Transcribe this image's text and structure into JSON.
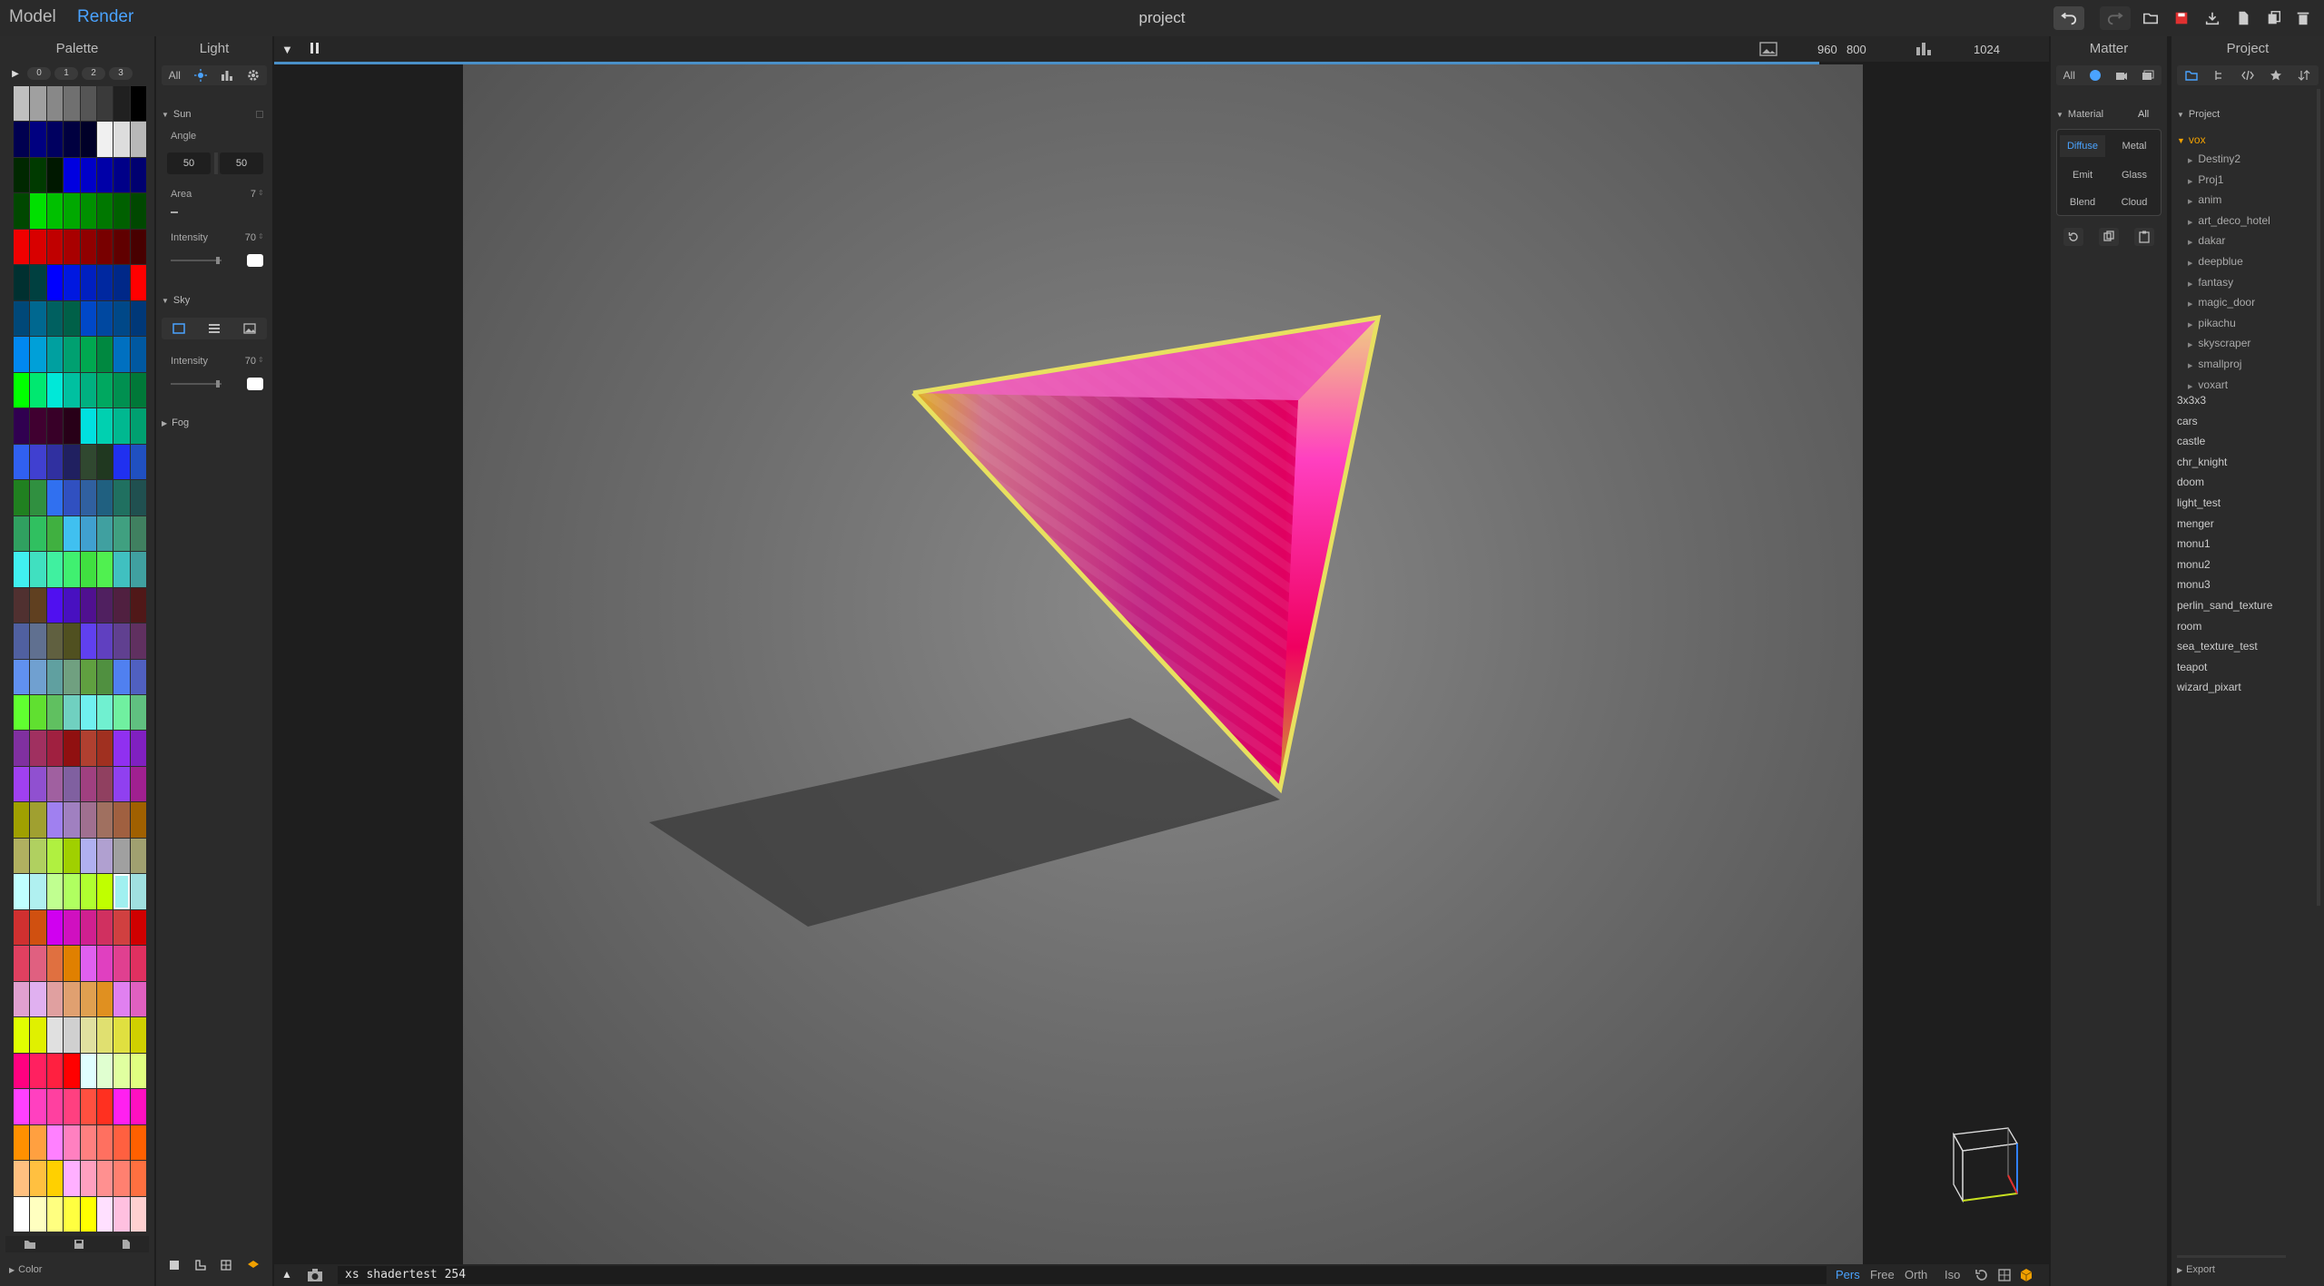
{
  "topbar": {
    "modes": [
      "Model",
      "Render"
    ],
    "active_mode": "Render",
    "title": "project",
    "icons": [
      "undo-icon",
      "redo-icon",
      "open-folder-icon",
      "save-icon",
      "download-icon",
      "new-file-icon",
      "duplicate-icon",
      "trash-icon"
    ]
  },
  "palette": {
    "title": "Palette",
    "play_label": "▶",
    "tabs": [
      "0",
      "1",
      "2",
      "3"
    ],
    "colors": [
      "#c0c0c0",
      "#a0a0a0",
      "#888888",
      "#707070",
      "#555555",
      "#3a3a3a",
      "#202020",
      "#000000",
      "#000050",
      "#000080",
      "#000060",
      "#000040",
      "#000028",
      "#f0f0f0",
      "#dddddd",
      "#b8b8b8",
      "#002800",
      "#003a00",
      "#001800",
      "#0000e0",
      "#0000c8",
      "#0000a8",
      "#000088",
      "#000070",
      "#004800",
      "#00e000",
      "#00c000",
      "#00a800",
      "#009000",
      "#007800",
      "#006000",
      "#004800",
      "#f00000",
      "#d80000",
      "#c00000",
      "#a80000",
      "#900000",
      "#780000",
      "#600000",
      "#480000",
      "#003030",
      "#004040",
      "#0000ff",
      "#0018e0",
      "#0020c0",
      "#0028a0",
      "#002888",
      "#ff0000",
      "#004878",
      "#006890",
      "#006060",
      "#006048",
      "#0048c8",
      "#0048a0",
      "#004888",
      "#003878",
      "#0088f0",
      "#00a0d8",
      "#00a0a0",
      "#00a070",
      "#00a850",
      "#008840",
      "#0070c0",
      "#0058a0",
      "#00ff00",
      "#00e870",
      "#00e8d8",
      "#00c0a0",
      "#00b080",
      "#00a860",
      "#009050",
      "#007838",
      "#300050",
      "#400030",
      "#380028",
      "#280018",
      "#00e0e0",
      "#00d0b0",
      "#00b890",
      "#00a070",
      "#3060f0",
      "#4040d0",
      "#3030a0",
      "#202060",
      "#304830",
      "#203820",
      "#2030f0",
      "#2050c0",
      "#208020",
      "#309040",
      "#3070f0",
      "#3050c0",
      "#3060a0",
      "#206080",
      "#207060",
      "#205050",
      "#30a060",
      "#30c060",
      "#40b040",
      "#40c0f0",
      "#40a0d0",
      "#40a0a0",
      "#40a080",
      "#408060",
      "#40f0f0",
      "#40e0c0",
      "#40f0a0",
      "#40f070",
      "#40e040",
      "#50f050",
      "#40c0c0",
      "#40a0a0",
      "#503030",
      "#604020",
      "#5010f0",
      "#4810c0",
      "#501090",
      "#502060",
      "#502040",
      "#501818",
      "#5060a0",
      "#607090",
      "#606040",
      "#505020",
      "#6040f0",
      "#6040c0",
      "#604090",
      "#603060",
      "#6090f0",
      "#70a0d0",
      "#60a0a0",
      "#70a080",
      "#60a040",
      "#509040",
      "#5080f0",
      "#5060c0",
      "#60ff30",
      "#60e030",
      "#60c060",
      "#70d0c0",
      "#70f0f0",
      "#70f0d0",
      "#70f0a0",
      "#60c080",
      "#8030a0",
      "#a03060",
      "#a02040",
      "#901010",
      "#b04030",
      "#a03020",
      "#9030f0",
      "#8020c0",
      "#a040f0",
      "#9050d0",
      "#a060a0",
      "#8060a0",
      "#a04080",
      "#904060",
      "#9040f0",
      "#a02090",
      "#a0a000",
      "#a0a030",
      "#a080f0",
      "#a080c0",
      "#a07090",
      "#a07060",
      "#a06040",
      "#a06000",
      "#b0b060",
      "#b0d060",
      "#b0f040",
      "#a0d000",
      "#b0b0f0",
      "#b0a0d0",
      "#a0a0a0",
      "#a0a070",
      "#c0ffff",
      "#b0f0f0",
      "#c0ff90",
      "#b0ff60",
      "#b0ff30",
      "#c0ff00",
      "#a0f0f0",
      "#a0e0e0",
      "#d03030",
      "#d05010",
      "#d000f0",
      "#d010c0",
      "#d02090",
      "#d03060",
      "#d04040",
      "#d00000",
      "#e04060",
      "#e06080",
      "#e07040",
      "#e08000",
      "#e060f0",
      "#e040c0",
      "#e04090",
      "#e03060",
      "#e0a0d0",
      "#e0b0f0",
      "#e0a0a0",
      "#e0a070",
      "#e0a050",
      "#e09020",
      "#e080f0",
      "#e060c0",
      "#e0ff00",
      "#e0f000",
      "#e0e0e0",
      "#d0d0d0",
      "#e0e0a0",
      "#e0e070",
      "#e0e040",
      "#d0d000",
      "#ff0080",
      "#ff2060",
      "#ff2040",
      "#ff0000",
      "#e0ffff",
      "#e0ffd0",
      "#e0ffa0",
      "#e0ff80",
      "#ff40ff",
      "#ff40c0",
      "#ff40a0",
      "#ff4080",
      "#ff5040",
      "#ff3020",
      "#ff20f0",
      "#ff10c0",
      "#ff9000",
      "#ffa040",
      "#ff80ff",
      "#ff80c0",
      "#ff8080",
      "#ff7060",
      "#ff6040",
      "#ff6000",
      "#ffc080",
      "#ffc040",
      "#ffd000",
      "#ffb0ff",
      "#ffa0c0",
      "#ff9090",
      "#ff8070",
      "#ff7040",
      "#ffffff",
      "#ffffc0",
      "#ffff80",
      "#ffff40",
      "#ffff00",
      "#ffe0ff",
      "#ffc0e0",
      "#ffd0d0"
    ],
    "selected_index": 182,
    "footer_icons": [
      "folder-icon",
      "save-icon",
      "file-icon"
    ],
    "bottom_label": "Color"
  },
  "light": {
    "title": "Light",
    "filter_all": "All",
    "sun": {
      "label": "Sun",
      "angle_label": "Angle",
      "angle_a": "50",
      "angle_b": "50",
      "area_label": "Area",
      "area_value": "7",
      "intensity_label": "Intensity",
      "intensity_value": "70",
      "intensity_level": 0.7
    },
    "sky": {
      "label": "Sky",
      "intensity_label": "Intensity",
      "intensity_value": "70",
      "intensity_level": 0.7
    },
    "fog": {
      "label": "Fog"
    }
  },
  "viewport": {
    "resolution_w": "960",
    "resolution_h": "800",
    "samples": "1024",
    "progress": 1.0,
    "command_value": "xs shadertest 254",
    "view_modes": [
      "Pers",
      "Free",
      "Orth",
      "Iso"
    ],
    "active_view": "Pers"
  },
  "matter": {
    "title": "Matter",
    "filter_all": "All",
    "material_label": "Material",
    "material_all": "All",
    "materials": [
      "Diffuse",
      "Metal",
      "Emit",
      "Glass",
      "Blend",
      "Cloud"
    ],
    "active_material": "Diffuse"
  },
  "project": {
    "title": "Project",
    "root_label": "Project",
    "folder": "vox",
    "subfolders": [
      "Destiny2",
      "Proj1",
      "anim",
      "art_deco_hotel",
      "dakar",
      "deepblue",
      "fantasy",
      "magic_door",
      "pikachu",
      "skyscraper",
      "smallproj",
      "voxart"
    ],
    "files": [
      "3x3x3",
      "cars",
      "castle",
      "chr_knight",
      "doom",
      "light_test",
      "menger",
      "monu1",
      "monu2",
      "monu3",
      "perlin_sand_texture",
      "room",
      "sea_texture_test",
      "teapot",
      "wizard_pixart"
    ],
    "export_label": "Export"
  }
}
